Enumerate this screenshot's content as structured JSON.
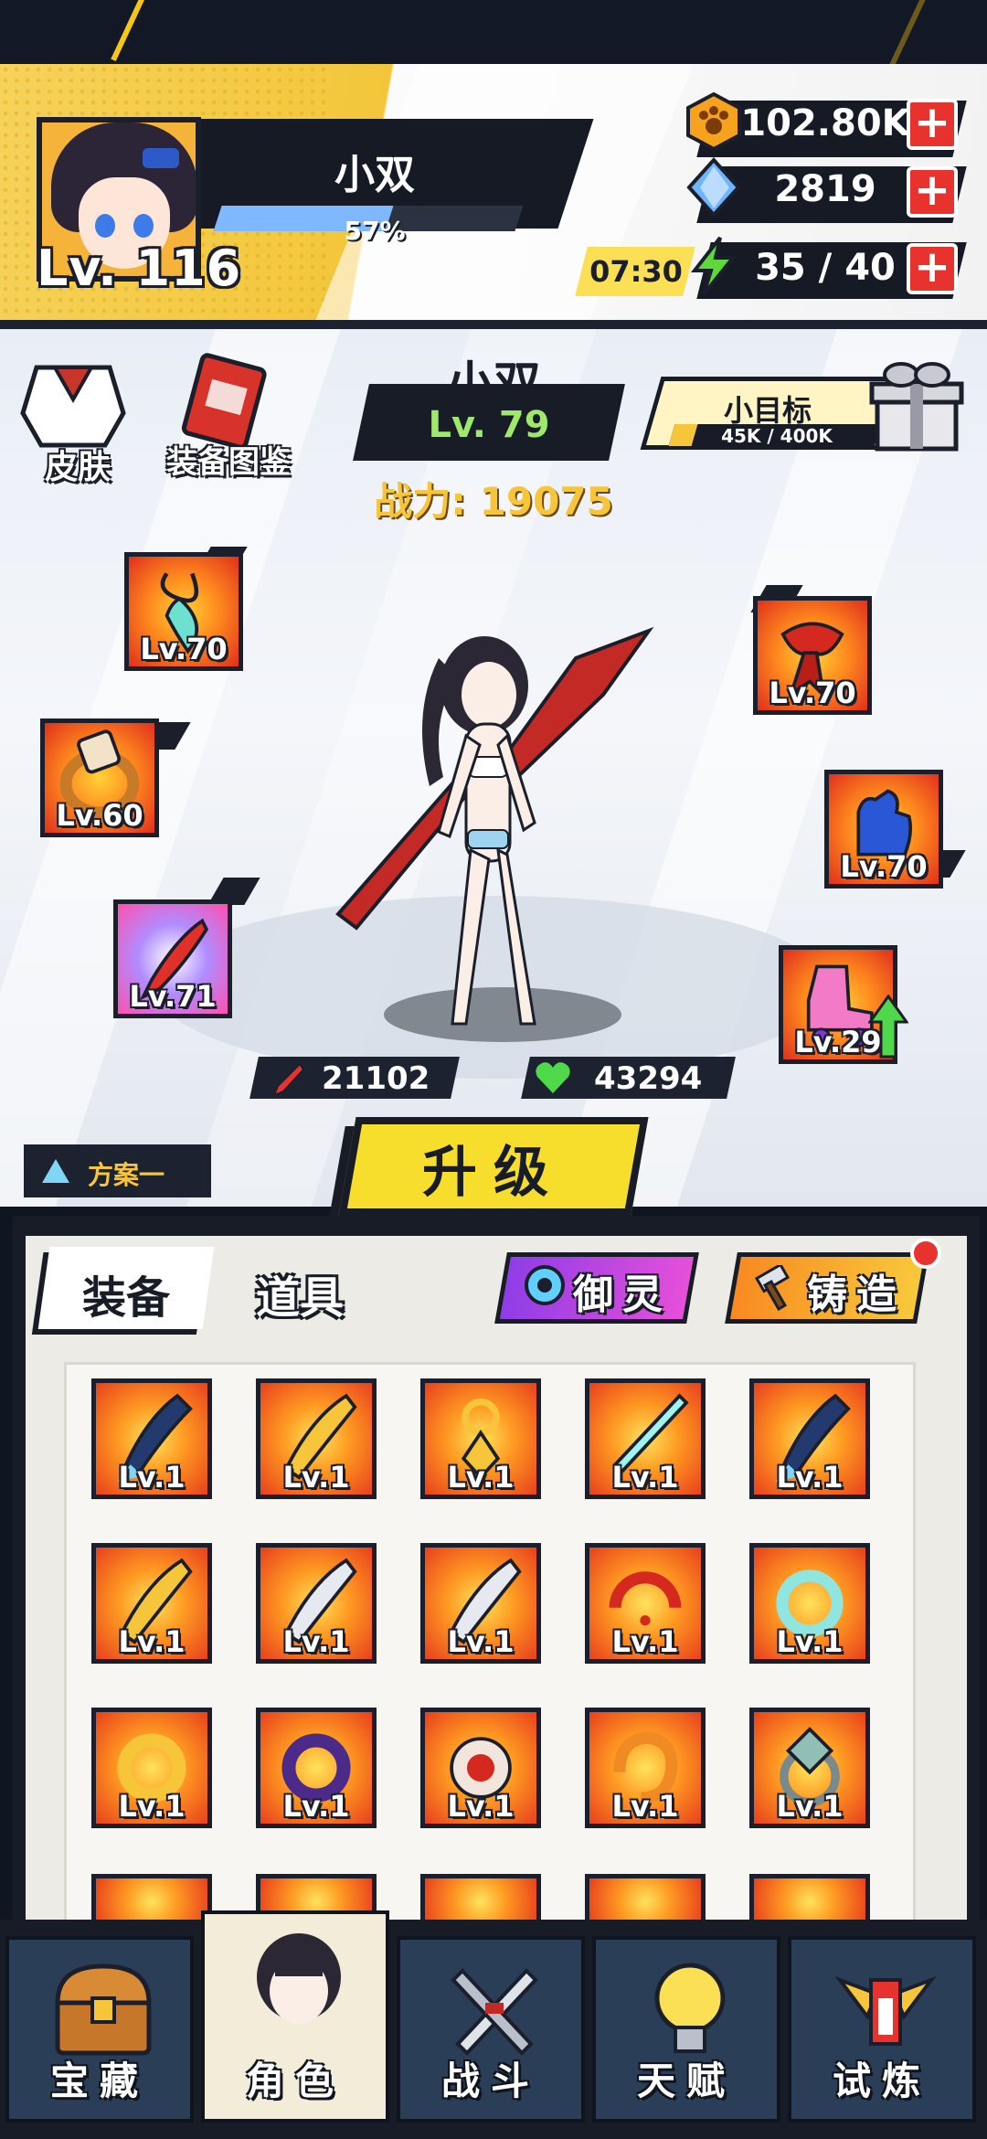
{
  "header": {
    "player_name": "小双",
    "player_level": "Lv. 116",
    "exp_percent_label": "57%",
    "exp_fraction": 0.57,
    "resources": {
      "gold": "102.80K",
      "gems": "2819",
      "energy_timer": "07:30",
      "energy": "35 / 40"
    }
  },
  "side_menu": {
    "skin_label": "皮肤",
    "codex_label": "装备图鉴"
  },
  "hero": {
    "name": "小双",
    "level": "Lv. 79",
    "power": "战力: 19075",
    "attack": "21102",
    "health": "43294"
  },
  "goal": {
    "title": "小目标",
    "progress": "45K / 400K",
    "fraction": 0.1125
  },
  "equipped": {
    "left": [
      {
        "name": "pendant",
        "level": "Lv.70"
      },
      {
        "name": "ring",
        "level": "Lv.60"
      },
      {
        "name": "blade",
        "level": "Lv.71"
      }
    ],
    "right": [
      {
        "name": "scarf",
        "level": "Lv.70"
      },
      {
        "name": "gloves",
        "level": "Lv.70"
      },
      {
        "name": "skates",
        "level": "Lv.29"
      }
    ]
  },
  "plan_label": "方案一",
  "upgrade_label": "升级",
  "inventory": {
    "tab_equip": "装备",
    "tab_items": "道具",
    "spirit_button": "御灵",
    "forge_button": "铸造",
    "items": [
      {
        "icon": "dark-blade",
        "level": "Lv.1"
      },
      {
        "icon": "gold-blade",
        "level": "Lv.1"
      },
      {
        "icon": "gold-pendant",
        "level": "Lv.1"
      },
      {
        "icon": "light-sword",
        "level": "Lv.1"
      },
      {
        "icon": "dark-blade",
        "level": "Lv.1"
      },
      {
        "icon": "gold-blade",
        "level": "Lv.1"
      },
      {
        "icon": "silver-blade",
        "level": "Lv.1"
      },
      {
        "icon": "silver-blade",
        "level": "Lv.1"
      },
      {
        "icon": "red-ring",
        "level": "Lv.1"
      },
      {
        "icon": "jade-ring",
        "level": "Lv.1"
      },
      {
        "icon": "gold-ring",
        "level": "Lv.1"
      },
      {
        "icon": "purple-ring",
        "level": "Lv.1"
      },
      {
        "icon": "seal-ring",
        "level": "Lv.1"
      },
      {
        "icon": "dragon-ring",
        "level": "Lv.1"
      },
      {
        "icon": "crystal-ring",
        "level": "Lv.1"
      }
    ]
  },
  "nav": {
    "treasure": "宝藏",
    "character": "角色",
    "battle": "战斗",
    "talent": "天赋",
    "trial": "试炼"
  },
  "colors": {
    "accent_yellow": "#f8de2c",
    "panel_dark": "#171c26",
    "nav_blue": "#2a3e58",
    "health_green": "#4fd84a",
    "attack_red": "#e8322d"
  }
}
